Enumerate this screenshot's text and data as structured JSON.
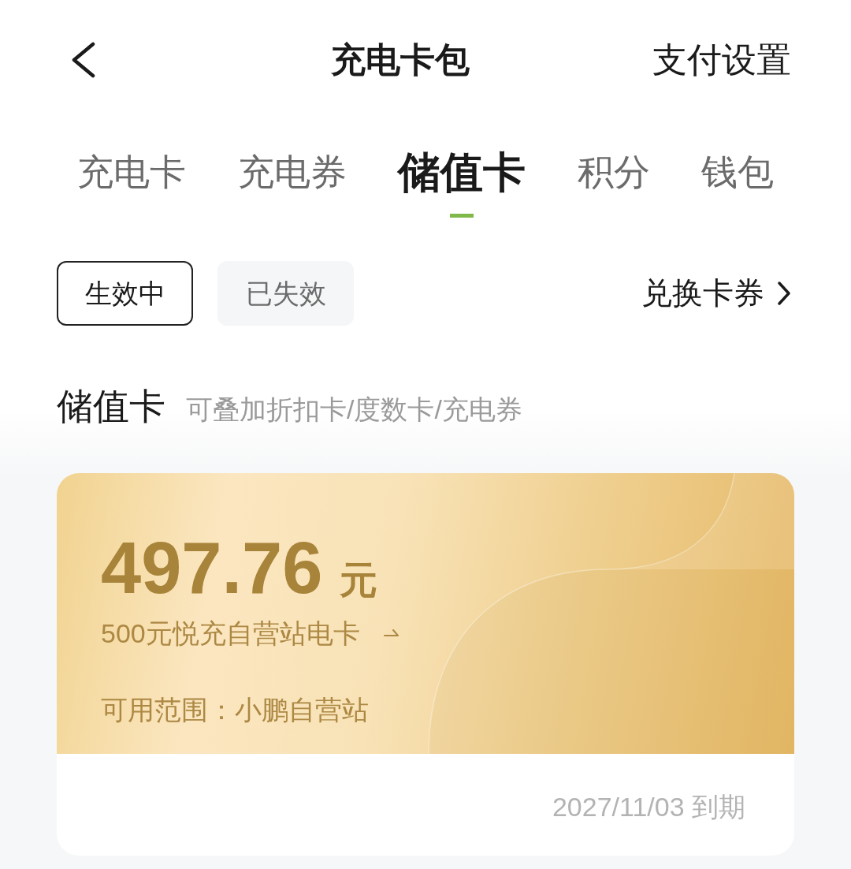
{
  "header": {
    "title": "充电卡包",
    "action": "支付设置"
  },
  "tabs": [
    {
      "label": "充电卡",
      "selected": false
    },
    {
      "label": "充电券",
      "selected": false
    },
    {
      "label": "储值卡",
      "selected": true
    },
    {
      "label": "积分",
      "selected": false
    },
    {
      "label": "钱包",
      "selected": false
    }
  ],
  "filters": [
    {
      "label": "生效中",
      "selected": true
    },
    {
      "label": "已失效",
      "selected": false
    }
  ],
  "redeem_link": "兑换卡券",
  "section": {
    "title": "储值卡",
    "subtitle": "可叠加折扣卡/度数卡/充电券"
  },
  "cards": [
    {
      "amount": "497.76",
      "unit": "元",
      "name": "500元悦充自营站电卡",
      "scope": "可用范围：小鹏自营站",
      "expiry": "2027/11/03 到期"
    }
  ]
}
